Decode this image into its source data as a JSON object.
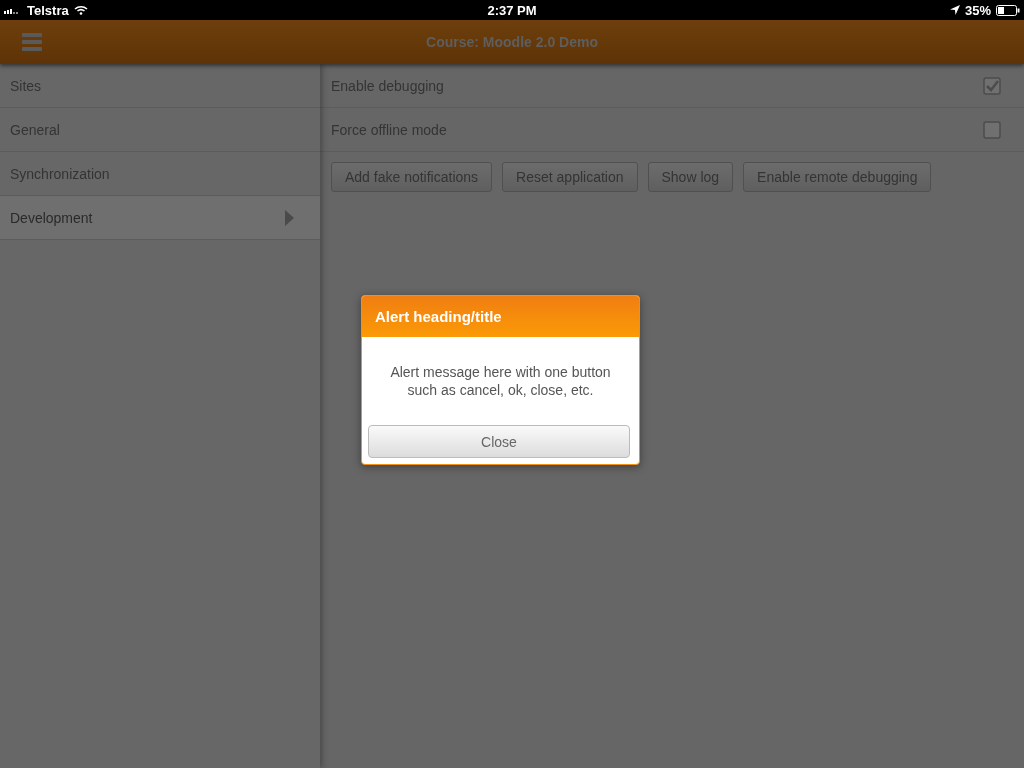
{
  "status_bar": {
    "carrier": "Telstra",
    "time": "2:37 PM",
    "battery": "35%"
  },
  "header": {
    "title": "Course: Moodle 2.0 Demo"
  },
  "sidebar": {
    "items": [
      {
        "label": "Sites",
        "selected": false
      },
      {
        "label": "General",
        "selected": false
      },
      {
        "label": "Synchronization",
        "selected": false
      },
      {
        "label": "Development",
        "selected": true
      }
    ]
  },
  "settings": [
    {
      "label": "Enable debugging",
      "checked": true
    },
    {
      "label": "Force offline mode",
      "checked": false
    }
  ],
  "buttons": [
    "Add fake notifications",
    "Reset application",
    "Show log",
    "Enable remote debugging"
  ],
  "alert": {
    "title": "Alert heading/title",
    "message": "Alert message here with one button such as cancel, ok, close, etc.",
    "button": "Close"
  }
}
